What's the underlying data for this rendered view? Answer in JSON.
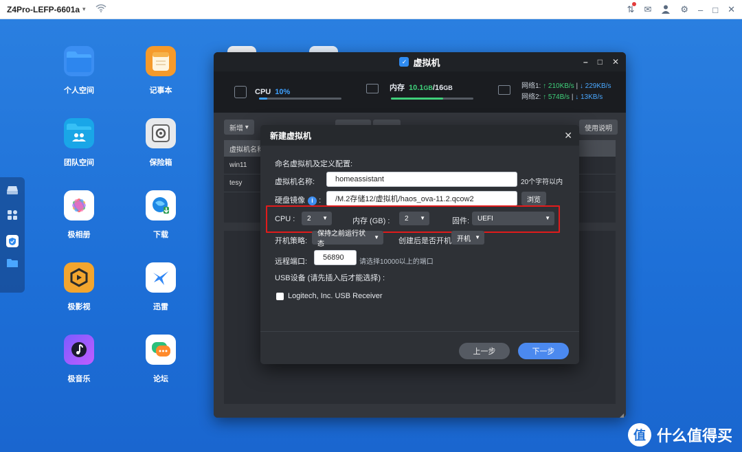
{
  "titlebar": {
    "device_name": "Z4Pro-LEFP-6601a"
  },
  "desktop_apps": [
    {
      "label": "个人空间",
      "icon": "folder-icon"
    },
    {
      "label": "记事本",
      "icon": "notepad-icon"
    },
    {
      "label": "团队空间",
      "icon": "team-folder-icon"
    },
    {
      "label": "保险箱",
      "icon": "safe-icon"
    },
    {
      "label": "极相册",
      "icon": "photos-icon"
    },
    {
      "label": "下载",
      "icon": "download-icon"
    },
    {
      "label": "极影视",
      "icon": "video-icon"
    },
    {
      "label": "迅雷",
      "icon": "thunder-icon"
    },
    {
      "label": "极音乐",
      "icon": "music-icon"
    },
    {
      "label": "论坛",
      "icon": "forum-icon"
    }
  ],
  "vm_window": {
    "title": "虚拟机",
    "cpu_label": "CPU",
    "cpu_value": "10%",
    "cpu_fill": 0.1,
    "mem_label": "内存",
    "mem_used": "10.1",
    "mem_used_unit": "GB",
    "mem_sep": "/",
    "mem_total": "16",
    "mem_total_unit": "GB",
    "mem_fill": 0.63,
    "net1_label": "网络1:",
    "net1_up": "↑ 210KB/s",
    "net1_sep": "|",
    "net1_down": "↓ 229KB/s",
    "net2_label": "网络2:",
    "net2_up": "↑ 574B/s",
    "net2_sep": "|",
    "net2_down": "↓ 13KB/s",
    "toolbar_new": "新增",
    "toolbar_help": "使用说明",
    "table_header": "虚拟机名称",
    "rows": [
      "win11",
      "tesy"
    ]
  },
  "dialog": {
    "title": "新建虚拟机",
    "intro": "命名虚拟机及定义配置:",
    "name_label": "虚拟机名称:",
    "name_value": "homeassistant",
    "name_hint": "20个字符以内",
    "disk_label": "硬盘镜像",
    "disk_colon": ":",
    "disk_value": "/M.2存储12/虚拟机/haos_ova-11.2.qcow2",
    "browse_label": "浏览",
    "cpu_label": "CPU :",
    "cpu_value": "2",
    "mem_label": "内存 (GB) :",
    "mem_value": "2",
    "firmware_label": "固件:",
    "firmware_value": "UEFI",
    "boot_policy_label": "开机策略:",
    "boot_policy_value": "保持之前运行状态",
    "start_after_label": "创建后是否开机:",
    "start_after_value": "开机",
    "remote_port_label": "远程端口:",
    "remote_port_value": "56890",
    "remote_port_hint": "请选择10000以上的端口",
    "usb_label": "USB设备 (请先插入后才能选择) :",
    "usb_device": "Logitech, Inc. USB Receiver",
    "prev_label": "上一步",
    "next_label": "下一步"
  },
  "watermark": {
    "text": "什么值得买",
    "logo": "值"
  }
}
